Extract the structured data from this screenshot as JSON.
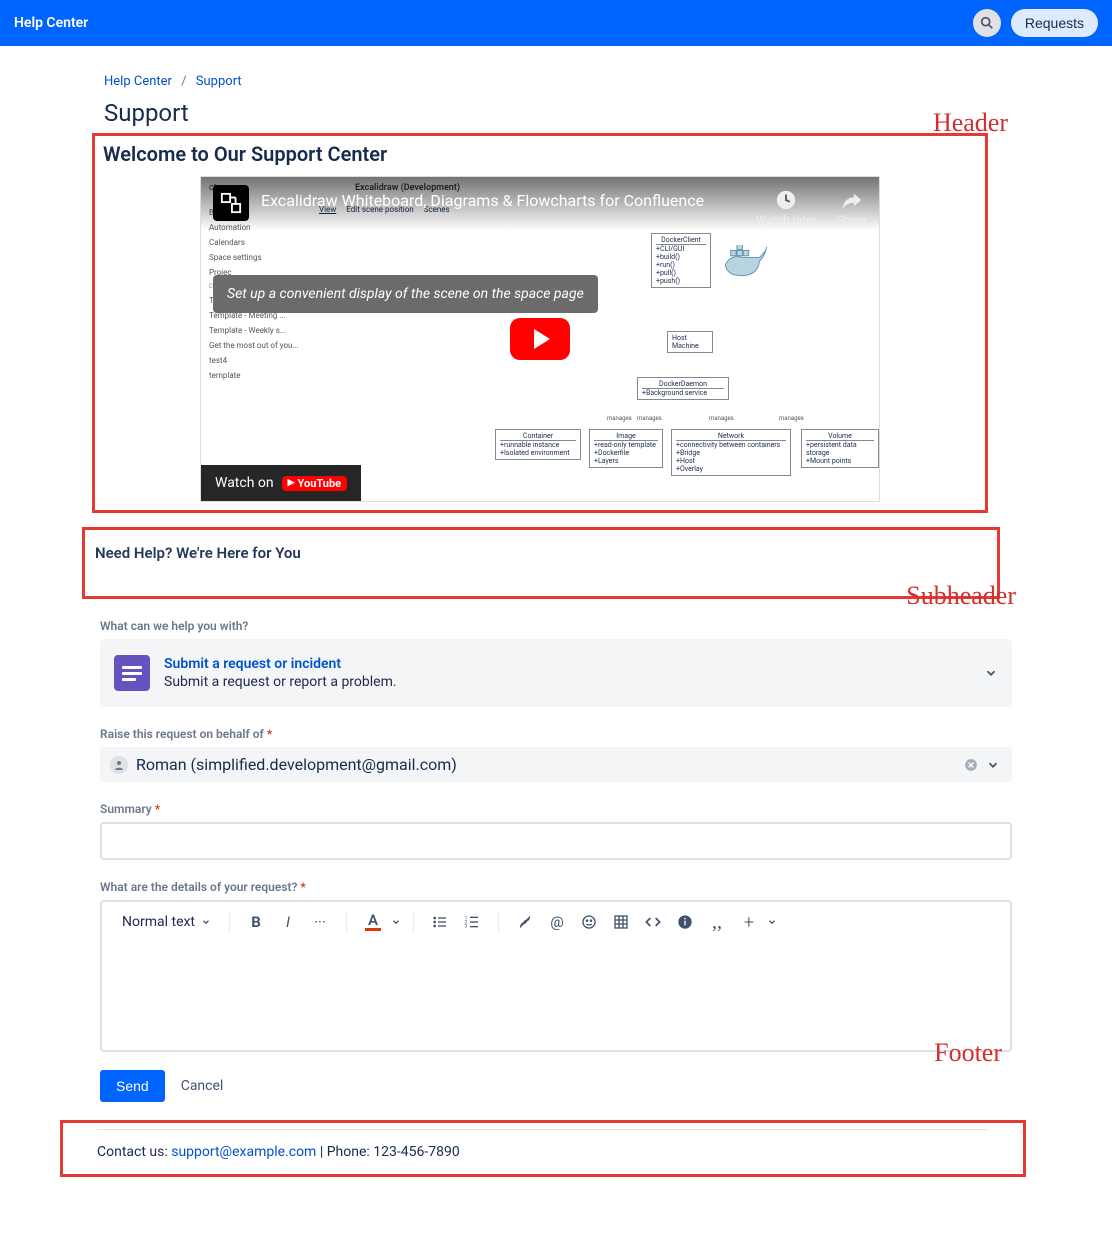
{
  "topbar": {
    "title": "Help Center",
    "requests_label": "Requests"
  },
  "breadcrumb": {
    "home": "Help Center",
    "current": "Support"
  },
  "page_title": "Support",
  "annotations": {
    "header": "Header",
    "subheader": "Subheader",
    "footer": "Footer"
  },
  "welcome": {
    "heading": "Welcome to Our Support Center"
  },
  "video": {
    "title": "Excalidraw Whiteboard, Diagrams & Flowcharts for Confluence",
    "watch_later": "Watch later",
    "share": "Share",
    "watch_on": "Watch on",
    "platform": "YouTube",
    "tooltip": "Set up a convenient display of the scene on the space page",
    "page_header_space": "ct space",
    "page_title_dev": "Excalidraw (Development)",
    "tabs": [
      "View",
      "Edit scene position",
      "Scenes"
    ],
    "sidebar_items": [
      "Blogs",
      "Automation",
      "Calendars",
      "Space settings",
      "Projec",
      "CONTENT",
      "Template - Project p...",
      "Template - Meeting ...",
      "Template - Weekly s...",
      "Get the most out of you...",
      "test4",
      "template"
    ],
    "diagram": {
      "client": {
        "title": "DockerClient",
        "rows": [
          "+CLI/GUI",
          "+build()",
          "+run()",
          "+pull()",
          "+push()"
        ]
      },
      "host": {
        "rows": [
          "Host",
          "Machine"
        ]
      },
      "daemon": {
        "title": "DockerDaemon",
        "rows": [
          "+Background service"
        ]
      },
      "manages": "manages",
      "container": {
        "title": "Container",
        "rows": [
          "+runnable instance",
          "+Isolated environment"
        ]
      },
      "image": {
        "title": "Image",
        "rows": [
          "+read-only template",
          "+Dockerfile",
          "+Layers"
        ]
      },
      "network": {
        "title": "Network",
        "rows": [
          "+connectivity between containers",
          "+Bridge",
          "+Host",
          "+Overlay"
        ]
      },
      "volume": {
        "title": "Volume",
        "rows": [
          "+persistent data storage",
          "+Mount points"
        ]
      }
    }
  },
  "subheader": {
    "text": "Need Help? We're Here for You"
  },
  "form": {
    "what_label": "What can we help you with?",
    "request_type": {
      "title": "Submit a request or incident",
      "desc": "Submit a request or report a problem."
    },
    "behalf_label": "Raise this request on behalf of",
    "behalf_value": "Roman (simplified.development@gmail.com)",
    "summary_label": "Summary",
    "details_label": "What are the details of your request?",
    "text_style": "Normal text",
    "send": "Send",
    "cancel": "Cancel"
  },
  "footer": {
    "prefix": "Contact us: ",
    "email": "support@example.com",
    "phone_prefix": " | Phone: ",
    "phone": "123-456-7890"
  }
}
